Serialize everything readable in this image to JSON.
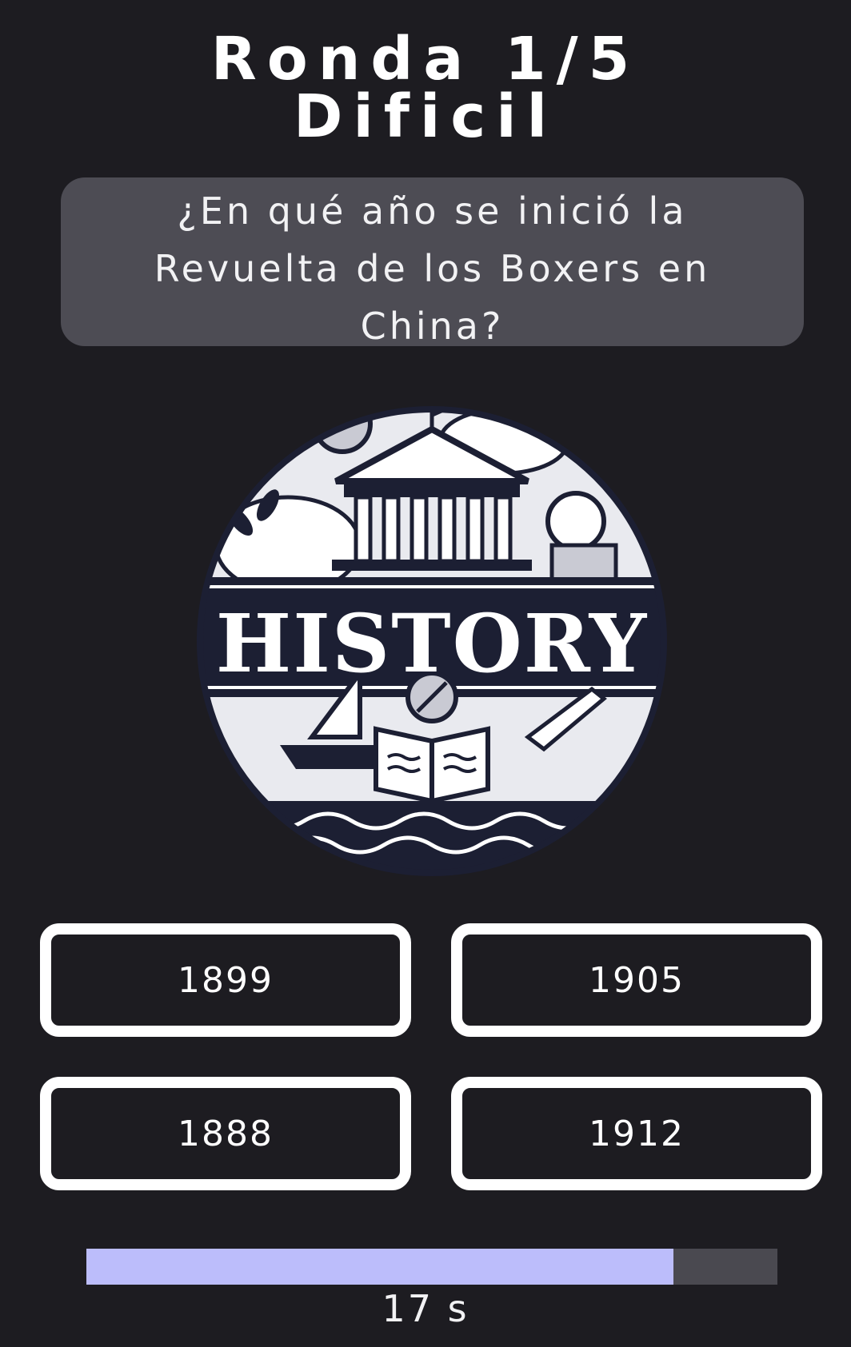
{
  "header": {
    "round": "Ronda 1/5",
    "difficulty": "Dificil"
  },
  "question": {
    "text": "¿En qué año se inició la Revuelta de los Boxers en China?"
  },
  "image": {
    "logo_text": "HISTORY"
  },
  "answers": [
    {
      "label": "1899"
    },
    {
      "label": "1905"
    },
    {
      "label": "1888"
    },
    {
      "label": "1912"
    }
  ],
  "timer": {
    "remaining_label": "17 s",
    "progress_fraction": 0.85
  },
  "colors": {
    "background": "#1d1c21",
    "question_box": "#4d4c54",
    "progress_fill": "#bcbdfb",
    "progress_track": "#4a4950",
    "logo_dark": "#1c1f33"
  }
}
